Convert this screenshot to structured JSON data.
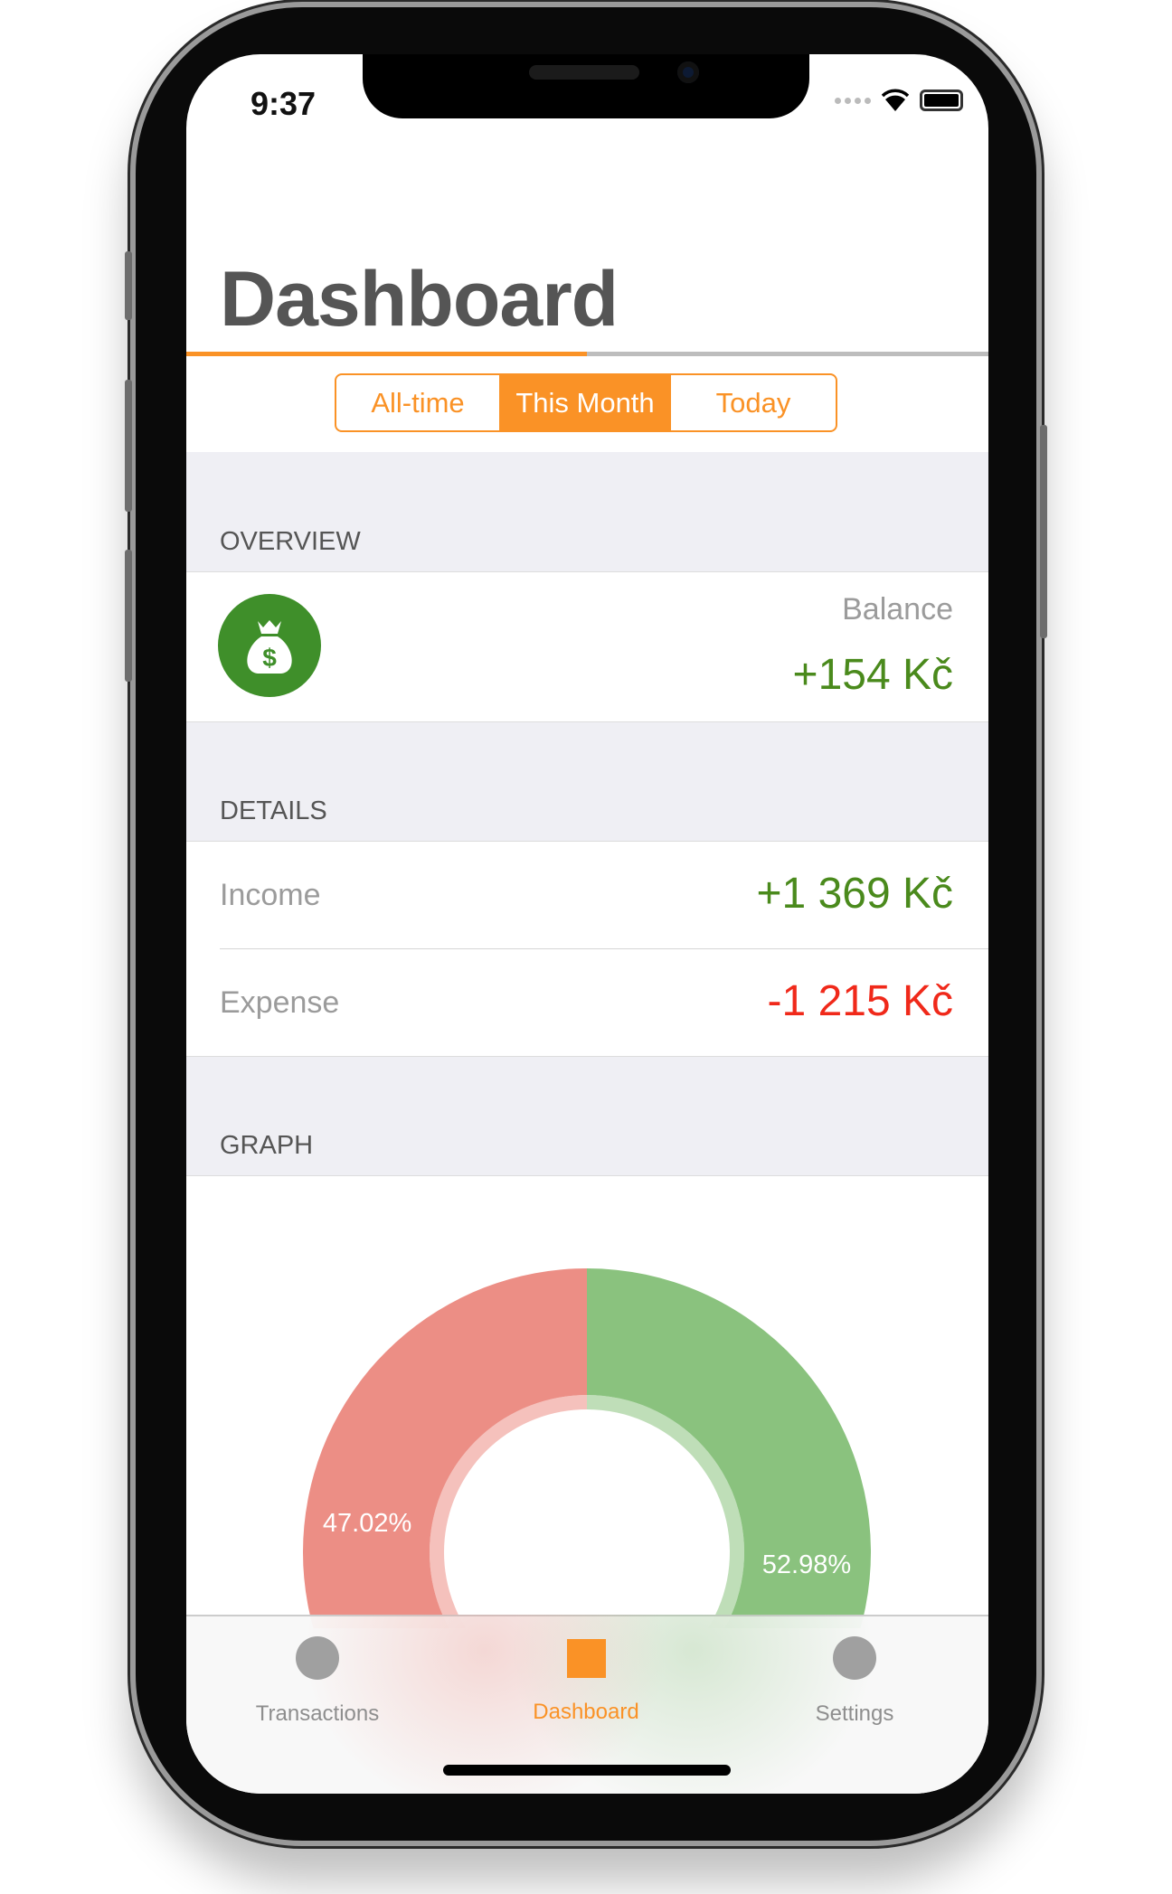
{
  "status_bar": {
    "time": "9:37"
  },
  "header": {
    "title": "Dashboard"
  },
  "segments": [
    {
      "label": "All-time",
      "selected": false
    },
    {
      "label": "This Month",
      "selected": true
    },
    {
      "label": "Today",
      "selected": false
    }
  ],
  "overview": {
    "section": "OVERVIEW",
    "icon": "money-bag-icon",
    "balance_label": "Balance",
    "balance_value": "+154 Kč"
  },
  "details": {
    "section": "DETAILS",
    "income_label": "Income",
    "income_value": "+1 369 Kč",
    "expense_label": "Expense",
    "expense_value": "-1 215 Kč"
  },
  "graph": {
    "section": "GRAPH"
  },
  "colors": {
    "accent": "#fa9226",
    "positive": "#4a8a1c",
    "negative": "#f0291a",
    "expense_slice": "#ec8e85",
    "income_slice": "#8ac27e"
  },
  "chart_data": {
    "type": "pie",
    "categories": [
      "Expense",
      "Income"
    ],
    "values": [
      47.02,
      52.98
    ],
    "labels": [
      "47.02%",
      "52.98%"
    ]
  },
  "tabbar": {
    "items": [
      {
        "label": "Transactions",
        "selected": false
      },
      {
        "label": "Dashboard",
        "selected": true
      },
      {
        "label": "Settings",
        "selected": false
      }
    ]
  }
}
